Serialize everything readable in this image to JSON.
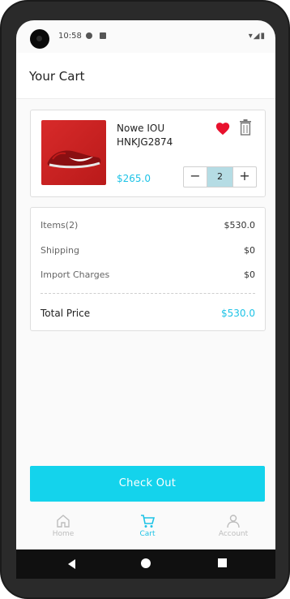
{
  "status": {
    "time": "10:58"
  },
  "appbar": {
    "title": "Your Cart"
  },
  "cart_item": {
    "name": "Nowe IOU HNKJG2874",
    "price": "$265.0",
    "quantity": "2",
    "minus_label": "−",
    "plus_label": "+",
    "heart_color": "#e8112d"
  },
  "summary": {
    "items_label": "Items(2)",
    "items_value": "$530.0",
    "shipping_label": "Shipping",
    "shipping_value": "$0",
    "import_label": "Import Charges",
    "import_value": "$0",
    "total_label": "Total Price",
    "total_value": "$530.0"
  },
  "checkout": {
    "label": "Check Out"
  },
  "bottom_nav": [
    {
      "label": "Home",
      "icon": "home-icon"
    },
    {
      "label": "Cart",
      "icon": "cart-icon",
      "active": true
    },
    {
      "label": "Account",
      "icon": "account-icon"
    }
  ],
  "colors": {
    "accent": "#14d3ec",
    "price": "#1ec3e6"
  }
}
